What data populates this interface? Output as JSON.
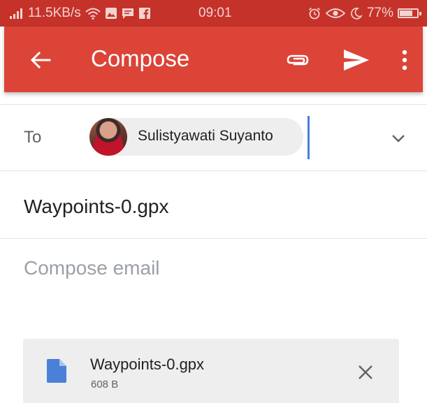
{
  "status_bar": {
    "speed": "11.5KB/s",
    "time": "09:01",
    "battery_percent": "77%",
    "battery_level": 0.77,
    "icons": [
      "signal-icon",
      "wifi-icon",
      "photo-notification-icon",
      "message-notification-icon",
      "facebook-notification-icon",
      "alarm-icon",
      "eye-comfort-icon",
      "do-not-disturb-icon",
      "battery-icon"
    ]
  },
  "app_bar": {
    "title": "Compose",
    "color": "#db4437",
    "actions": [
      "back-arrow-icon",
      "attach-icon",
      "send-icon",
      "more-vert-icon"
    ]
  },
  "to_field": {
    "label": "To",
    "recipient": {
      "name": "Sulistyawati Suyanto",
      "icon": "avatar"
    },
    "expand_icon": "chevron-down-icon"
  },
  "subject": {
    "value": "Waypoints-0.gpx"
  },
  "body": {
    "placeholder": "Compose email"
  },
  "attachment": {
    "file_name": "Waypoints-0.gpx",
    "file_size": "608 B",
    "icon": "file-icon",
    "icon_color": "#4a80d8",
    "remove_icon": "close-icon"
  }
}
